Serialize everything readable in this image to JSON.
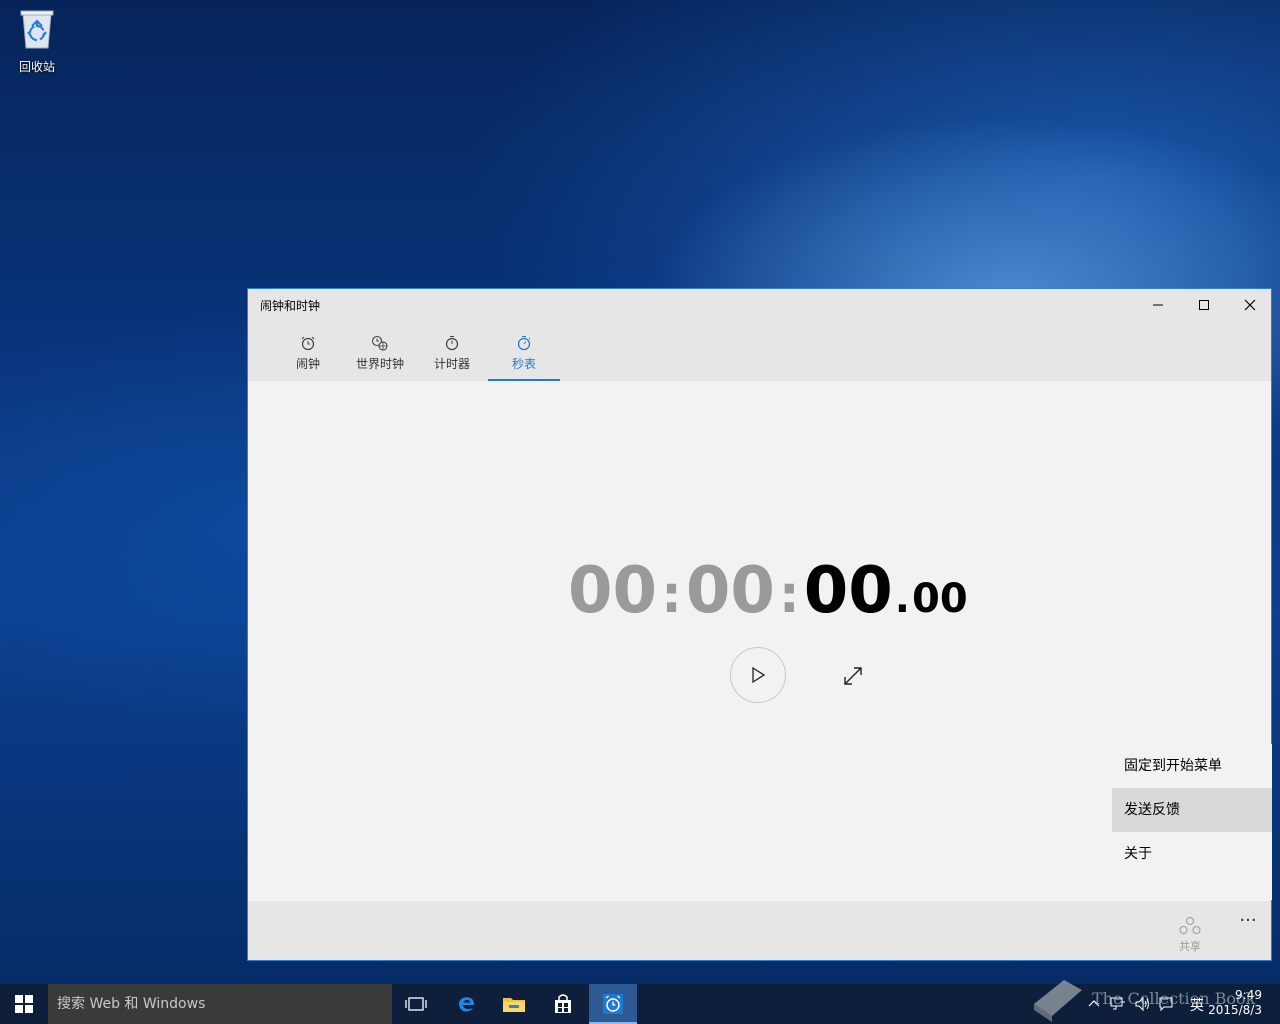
{
  "desktop": {
    "recycle_bin_label": "回收站"
  },
  "window": {
    "title": "闹钟和时钟",
    "tabs": [
      {
        "label": "闹钟",
        "icon": "alarm-clock-icon"
      },
      {
        "label": "世界时钟",
        "icon": "world-clock-icon"
      },
      {
        "label": "计时器",
        "icon": "timer-icon"
      },
      {
        "label": "秒表",
        "icon": "stopwatch-icon",
        "active": true
      }
    ],
    "stopwatch": {
      "hours": "00",
      "sep1": ":",
      "minutes": "00",
      "sep2": ":",
      "seconds": "00",
      "dot": ".",
      "hundredths": "00"
    },
    "menu": {
      "items": [
        {
          "label": "固定到开始菜单"
        },
        {
          "label": "发送反馈",
          "hover": true
        },
        {
          "label": "关于"
        }
      ]
    },
    "appbar": {
      "share_label": "共享",
      "more_label": "···"
    }
  },
  "taskbar": {
    "search_placeholder": "搜索 Web 和 Windows",
    "ime": "英",
    "time": "9:49",
    "date": "2015/8/3"
  },
  "watermark": {
    "text": "The Collection Book"
  },
  "colors": {
    "accent": "#1d7ad0",
    "window_border": "#2d7fd1",
    "taskbar": "#0d1f3a"
  }
}
